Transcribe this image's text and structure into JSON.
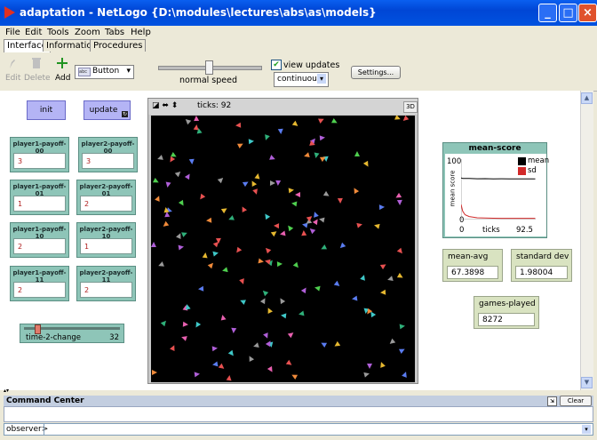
{
  "window": {
    "title": "adaptation - NetLogo {D:\\modules\\lectures\\abs\\as\\models}",
    "minimize": "_",
    "maximize": "□",
    "close": "×"
  },
  "menu": [
    "File",
    "Edit",
    "Tools",
    "Zoom",
    "Tabs",
    "Help"
  ],
  "tabs": [
    "Interface",
    "Information",
    "Procedures"
  ],
  "toolbar": {
    "edit": "Edit",
    "delete": "Delete",
    "add": "Add",
    "widget_type": "Button",
    "speed_label": "normal speed",
    "view_updates_label": "view updates",
    "view_updates_checked": true,
    "update_mode": "continuous",
    "settings": "Settings..."
  },
  "buttons": {
    "init": "init",
    "update": "update"
  },
  "inputs": [
    {
      "label": "player1-payoff-00",
      "value": "3"
    },
    {
      "label": "player2-payoff-00",
      "value": "3"
    },
    {
      "label": "player1-payoff-01",
      "value": "1"
    },
    {
      "label": "player2-payoff-01",
      "value": "2"
    },
    {
      "label": "player1-payoff-10",
      "value": "2"
    },
    {
      "label": "player2-payoff-10",
      "value": "1"
    },
    {
      "label": "player1-payoff-11",
      "value": "2"
    },
    {
      "label": "player2-payoff-11",
      "value": "2"
    }
  ],
  "slider": {
    "label": "time-2-change",
    "value": "32",
    "fraction": 0.12
  },
  "view": {
    "ticks": "ticks: 92",
    "three_d": "3D"
  },
  "plot": {
    "title": "mean-score",
    "ylabel": "mean score",
    "xlabel": "ticks",
    "ymax": "100",
    "ymin": "0",
    "xmin": "0",
    "xmax": "92.5",
    "legend": [
      {
        "name": "mean",
        "color": "#000000"
      },
      {
        "name": "sd",
        "color": "#d22a2a"
      }
    ]
  },
  "chart_data": {
    "type": "line",
    "title": "mean-score",
    "xlabel": "ticks",
    "ylabel": "mean score",
    "xlim": [
      0,
      92.5
    ],
    "ylim": [
      0,
      100
    ],
    "x": [
      0,
      2,
      5,
      10,
      20,
      30,
      40,
      50,
      60,
      70,
      80,
      92
    ],
    "series": [
      {
        "name": "mean",
        "color": "#000000",
        "values": [
          69,
          68,
          68,
          68,
          67.5,
          67.6,
          67.4,
          67.5,
          67.3,
          67.4,
          67.4,
          67.4
        ]
      },
      {
        "name": "sd",
        "color": "#d22a2a",
        "values": [
          25,
          14,
          8,
          5,
          3,
          2.5,
          2.2,
          2.1,
          2,
          2,
          2,
          2
        ]
      }
    ]
  },
  "monitors": [
    {
      "label": "mean-avg",
      "value": "67.3898"
    },
    {
      "label": "standard dev",
      "value": "1.98004"
    },
    {
      "label": "games-played",
      "value": "8272"
    }
  ],
  "command_center": {
    "title": "Command Center",
    "clear": "Clear",
    "prompt": "observer>"
  },
  "turtle_colors": [
    "#e85151",
    "#4fcf4f",
    "#5a7cf0",
    "#e6b830",
    "#b05fd8",
    "#3fc8c8",
    "#f08a3a",
    "#9a9a9a",
    "#e860b0",
    "#2fb07a"
  ]
}
